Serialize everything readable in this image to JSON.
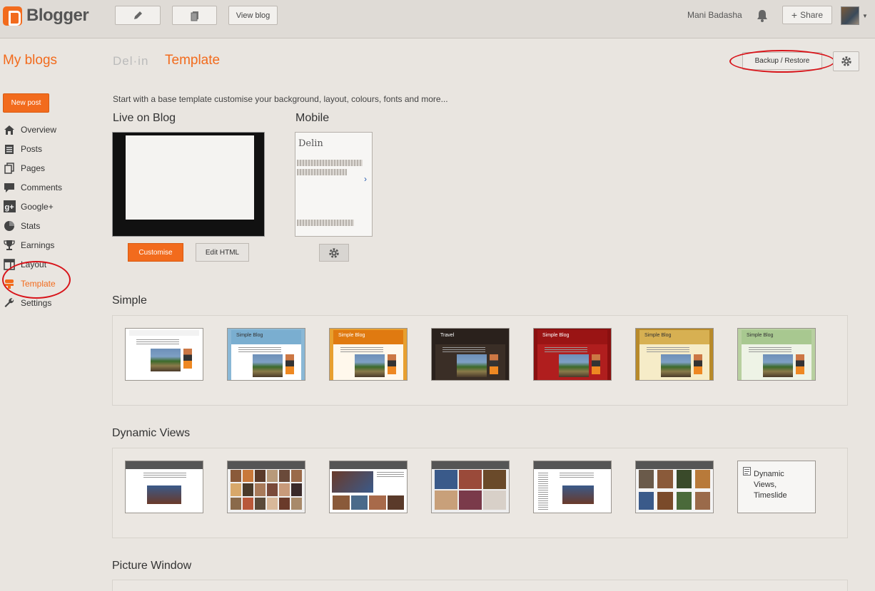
{
  "app": {
    "name": "Blogger"
  },
  "topbar": {
    "view_blog": "View blog",
    "user_name": "Mani Badasha",
    "share": "Share"
  },
  "header": {
    "my_blogs": "My blogs",
    "blog_name": "Del·in",
    "page_title": "Template",
    "backup_restore": "Backup / Restore"
  },
  "sidebar": {
    "new_post": "New post",
    "items": [
      {
        "label": "Overview",
        "icon": "home-icon"
      },
      {
        "label": "Posts",
        "icon": "posts-icon"
      },
      {
        "label": "Pages",
        "icon": "pages-icon"
      },
      {
        "label": "Comments",
        "icon": "comment-icon"
      },
      {
        "label": "Google+",
        "icon": "google-plus-icon"
      },
      {
        "label": "Stats",
        "icon": "stats-pie-icon"
      },
      {
        "label": "Earnings",
        "icon": "trophy-icon"
      },
      {
        "label": "Layout",
        "icon": "layout-icon"
      },
      {
        "label": "Template",
        "icon": "template-icon",
        "active": true
      },
      {
        "label": "Settings",
        "icon": "wrench-icon"
      }
    ]
  },
  "main": {
    "intro": "Start with a base template customise your background, layout, colours, fonts and more...",
    "live_label": "Live on Blog",
    "mobile_label": "Mobile",
    "mobile_preview_title": "Delin",
    "customise": "Customise",
    "edit_html": "Edit HTML",
    "sections": {
      "simple": "Simple",
      "dynamic": "Dynamic Views",
      "picture": "Picture Window"
    },
    "simple_thumbs": [
      {
        "title": "",
        "head": "#f2f2f2",
        "bg": "#ffffff",
        "frame": "#ffffff"
      },
      {
        "title": "Simple Blog",
        "head": "#7aaed0",
        "bg": "#ffffff",
        "frame": "#8ab8d6"
      },
      {
        "title": "Simple Blog",
        "head": "#e07a10",
        "bg": "#fff8ec",
        "frame": "#e8a030"
      },
      {
        "title": "Travel",
        "head": "#2a211c",
        "bg": "#3a2e26",
        "frame": "#2a211c"
      },
      {
        "title": "Simple Blog",
        "head": "#9a1414",
        "bg": "#b01e1e",
        "frame": "#8a1010"
      },
      {
        "title": "Simple Blog",
        "head": "#d7b052",
        "bg": "#f6ecc8",
        "frame": "#b88a2a"
      },
      {
        "title": "Simple Blog",
        "head": "#a8c890",
        "bg": "#eef3e6",
        "frame": "#b8d0a0"
      }
    ],
    "dynamic_last": "Dynamic Views, Timeslide",
    "colors": {
      "accent": "#f26b1d",
      "highlight": "#d8141a"
    }
  }
}
